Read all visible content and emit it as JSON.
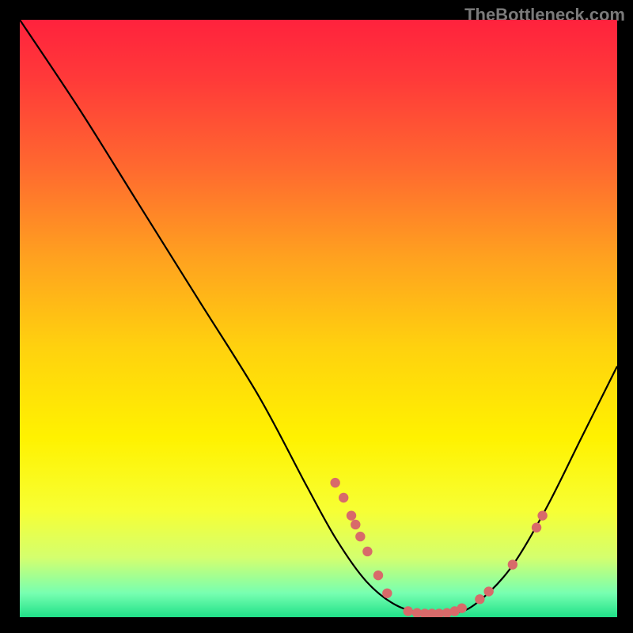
{
  "attribution": "TheBottleneck.com",
  "colors": {
    "gradient_stops": [
      {
        "offset": 0.0,
        "color": "#ff223d"
      },
      {
        "offset": 0.1,
        "color": "#ff3a39"
      },
      {
        "offset": 0.25,
        "color": "#ff6a2f"
      },
      {
        "offset": 0.4,
        "color": "#ffa21f"
      },
      {
        "offset": 0.55,
        "color": "#ffd20e"
      },
      {
        "offset": 0.7,
        "color": "#fff200"
      },
      {
        "offset": 0.82,
        "color": "#f7ff33"
      },
      {
        "offset": 0.9,
        "color": "#d4ff6e"
      },
      {
        "offset": 0.96,
        "color": "#77ffb1"
      },
      {
        "offset": 1.0,
        "color": "#20e088"
      }
    ],
    "curve": "#000000",
    "dot": "#d86a6a"
  },
  "chart_data": {
    "type": "line",
    "title": "",
    "xlabel": "",
    "ylabel": "",
    "xlim": [
      0,
      100
    ],
    "ylim": [
      0,
      100
    ],
    "curve": [
      {
        "x": 0,
        "y": 100
      },
      {
        "x": 10,
        "y": 85
      },
      {
        "x": 20,
        "y": 69
      },
      {
        "x": 30,
        "y": 53
      },
      {
        "x": 40,
        "y": 37
      },
      {
        "x": 48,
        "y": 22
      },
      {
        "x": 53,
        "y": 13
      },
      {
        "x": 58,
        "y": 6
      },
      {
        "x": 63,
        "y": 2
      },
      {
        "x": 68,
        "y": 0.6
      },
      {
        "x": 72,
        "y": 0.6
      },
      {
        "x": 76,
        "y": 2
      },
      {
        "x": 82,
        "y": 8
      },
      {
        "x": 88,
        "y": 18
      },
      {
        "x": 94,
        "y": 30
      },
      {
        "x": 100,
        "y": 42
      }
    ],
    "dots": [
      {
        "x": 52.8,
        "y": 22.5
      },
      {
        "x": 54.2,
        "y": 20.0
      },
      {
        "x": 55.5,
        "y": 17.0
      },
      {
        "x": 56.2,
        "y": 15.5
      },
      {
        "x": 57.0,
        "y": 13.5
      },
      {
        "x": 58.2,
        "y": 11.0
      },
      {
        "x": 60.0,
        "y": 7.0
      },
      {
        "x": 61.5,
        "y": 4.0
      },
      {
        "x": 65.0,
        "y": 1.0
      },
      {
        "x": 66.5,
        "y": 0.7
      },
      {
        "x": 67.8,
        "y": 0.6
      },
      {
        "x": 69.0,
        "y": 0.6
      },
      {
        "x": 70.2,
        "y": 0.6
      },
      {
        "x": 71.5,
        "y": 0.7
      },
      {
        "x": 72.8,
        "y": 1.0
      },
      {
        "x": 74.0,
        "y": 1.5
      },
      {
        "x": 77.0,
        "y": 3.0
      },
      {
        "x": 78.5,
        "y": 4.3
      },
      {
        "x": 82.5,
        "y": 8.8
      },
      {
        "x": 86.5,
        "y": 15.0
      },
      {
        "x": 87.5,
        "y": 17.0
      }
    ]
  }
}
